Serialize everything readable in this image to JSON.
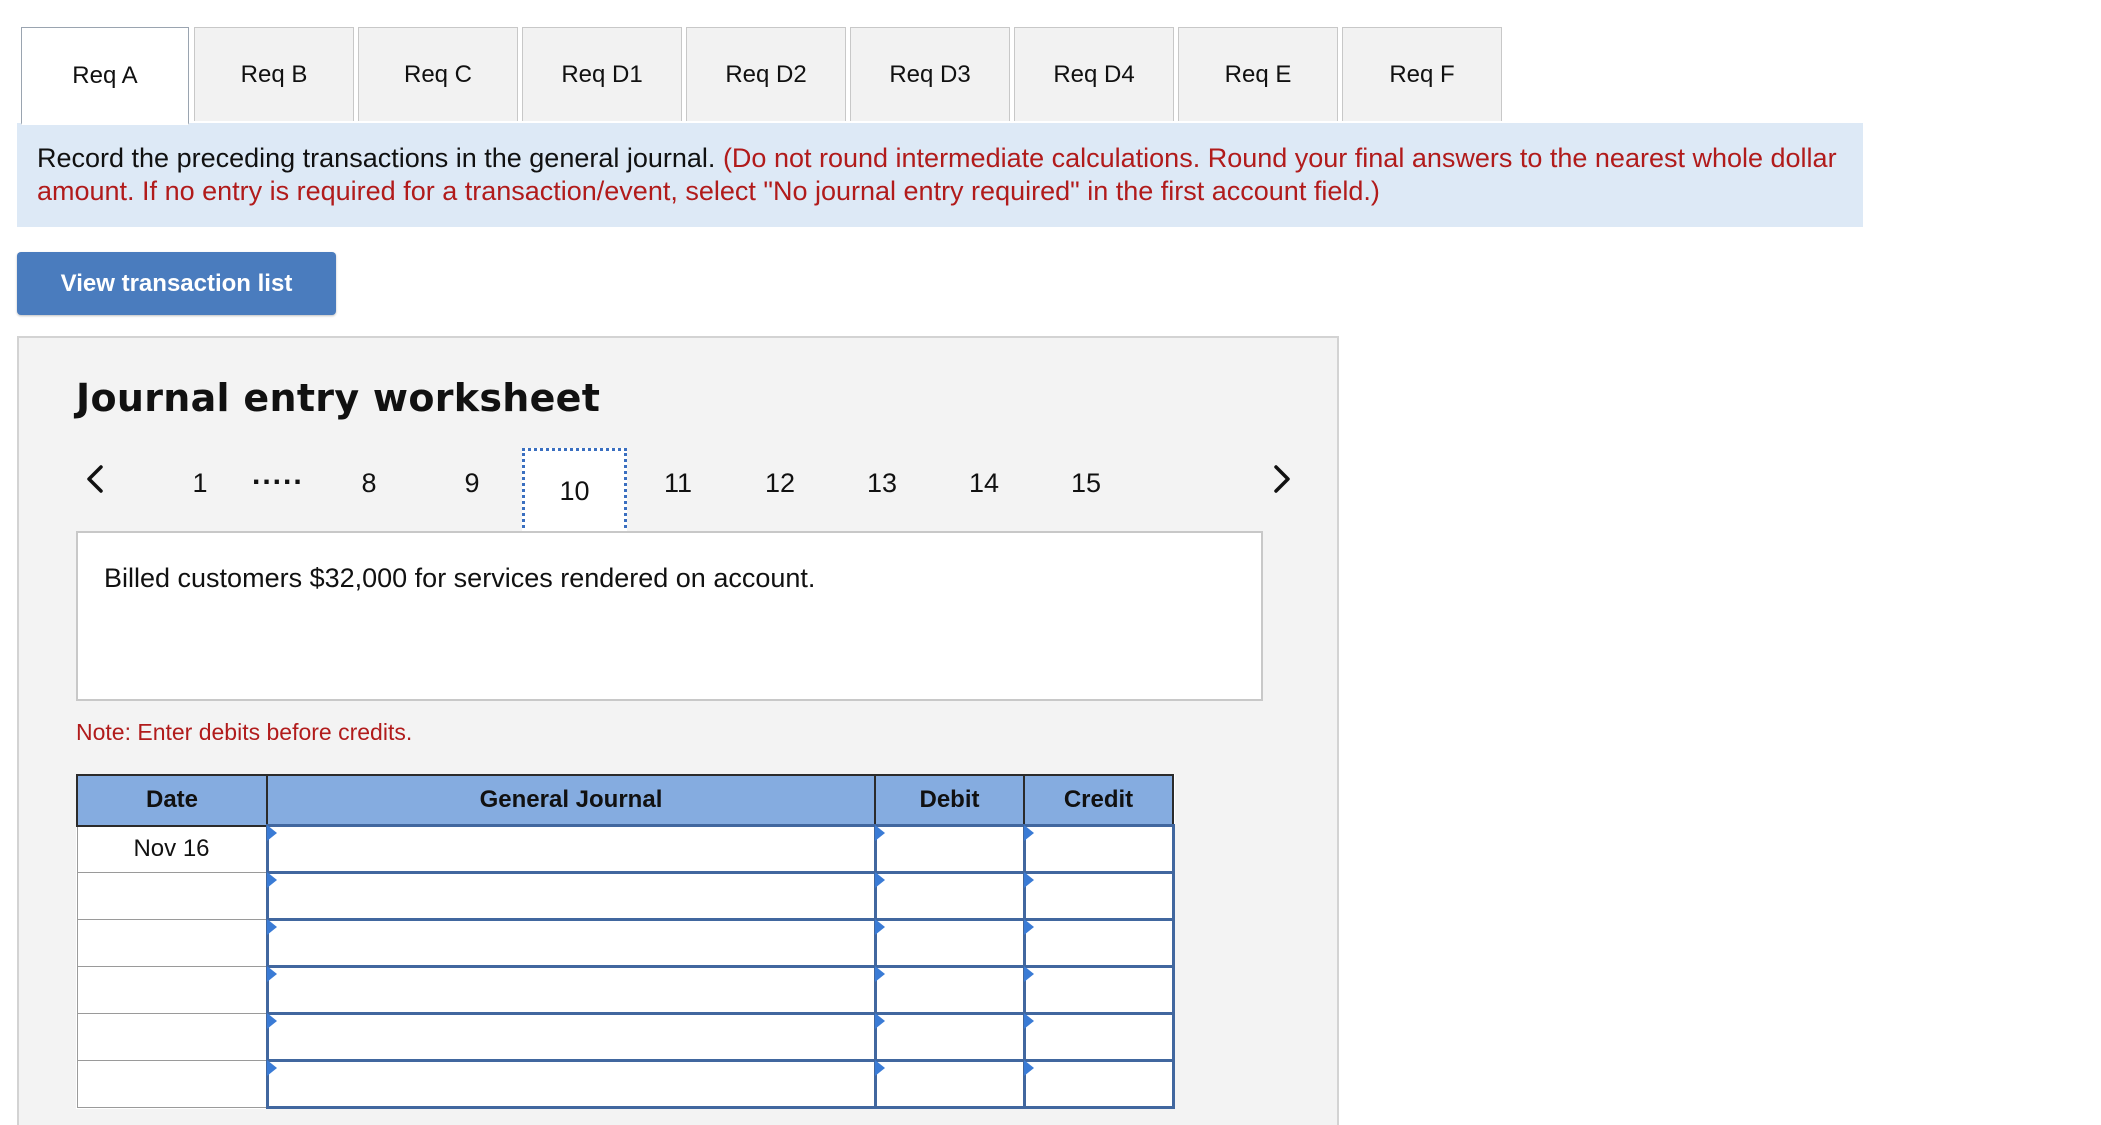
{
  "tabs": [
    "Req A",
    "Req B",
    "Req C",
    "Req D1",
    "Req D2",
    "Req D3",
    "Req D4",
    "Req E",
    "Req F"
  ],
  "active_tab": "Req A",
  "instructions": {
    "main": "Record the preceding transactions in the general journal.",
    "note": "(Do not round intermediate calculations. Round your final answers to the nearest whole dollar amount. If no entry is required for a transaction/event, select \"No journal entry required\" in the first account field.)"
  },
  "view_button": "View transaction list",
  "worksheet": {
    "title": "Journal entry worksheet",
    "pager": {
      "first": "1",
      "dots": ".....",
      "pages": [
        "8",
        "9",
        "10",
        "11",
        "12",
        "13",
        "14",
        "15"
      ],
      "current": "10",
      "prev_icon": "chevron-left-icon",
      "next_icon": "chevron-right-icon"
    },
    "description": "Billed customers $32,000 for services rendered on account.",
    "note": "Note: Enter debits before credits.",
    "table": {
      "headers": {
        "date": "Date",
        "journal": "General Journal",
        "debit": "Debit",
        "credit": "Credit"
      },
      "rows": [
        {
          "date": "Nov 16",
          "account": "",
          "debit": "",
          "credit": ""
        },
        {
          "date": "",
          "account": "",
          "debit": "",
          "credit": ""
        },
        {
          "date": "",
          "account": "",
          "debit": "",
          "credit": ""
        },
        {
          "date": "",
          "account": "",
          "debit": "",
          "credit": ""
        },
        {
          "date": "",
          "account": "",
          "debit": "",
          "credit": ""
        },
        {
          "date": "",
          "account": "",
          "debit": "",
          "credit": ""
        }
      ]
    }
  },
  "colors": {
    "tab_bg": "#f2f2f2",
    "instruction_bg": "#dde9f6",
    "instruction_note": "#b11b1b",
    "button_bg": "#4a7cbe",
    "table_header_bg": "#85ace0",
    "cell_border": "#41679f"
  }
}
